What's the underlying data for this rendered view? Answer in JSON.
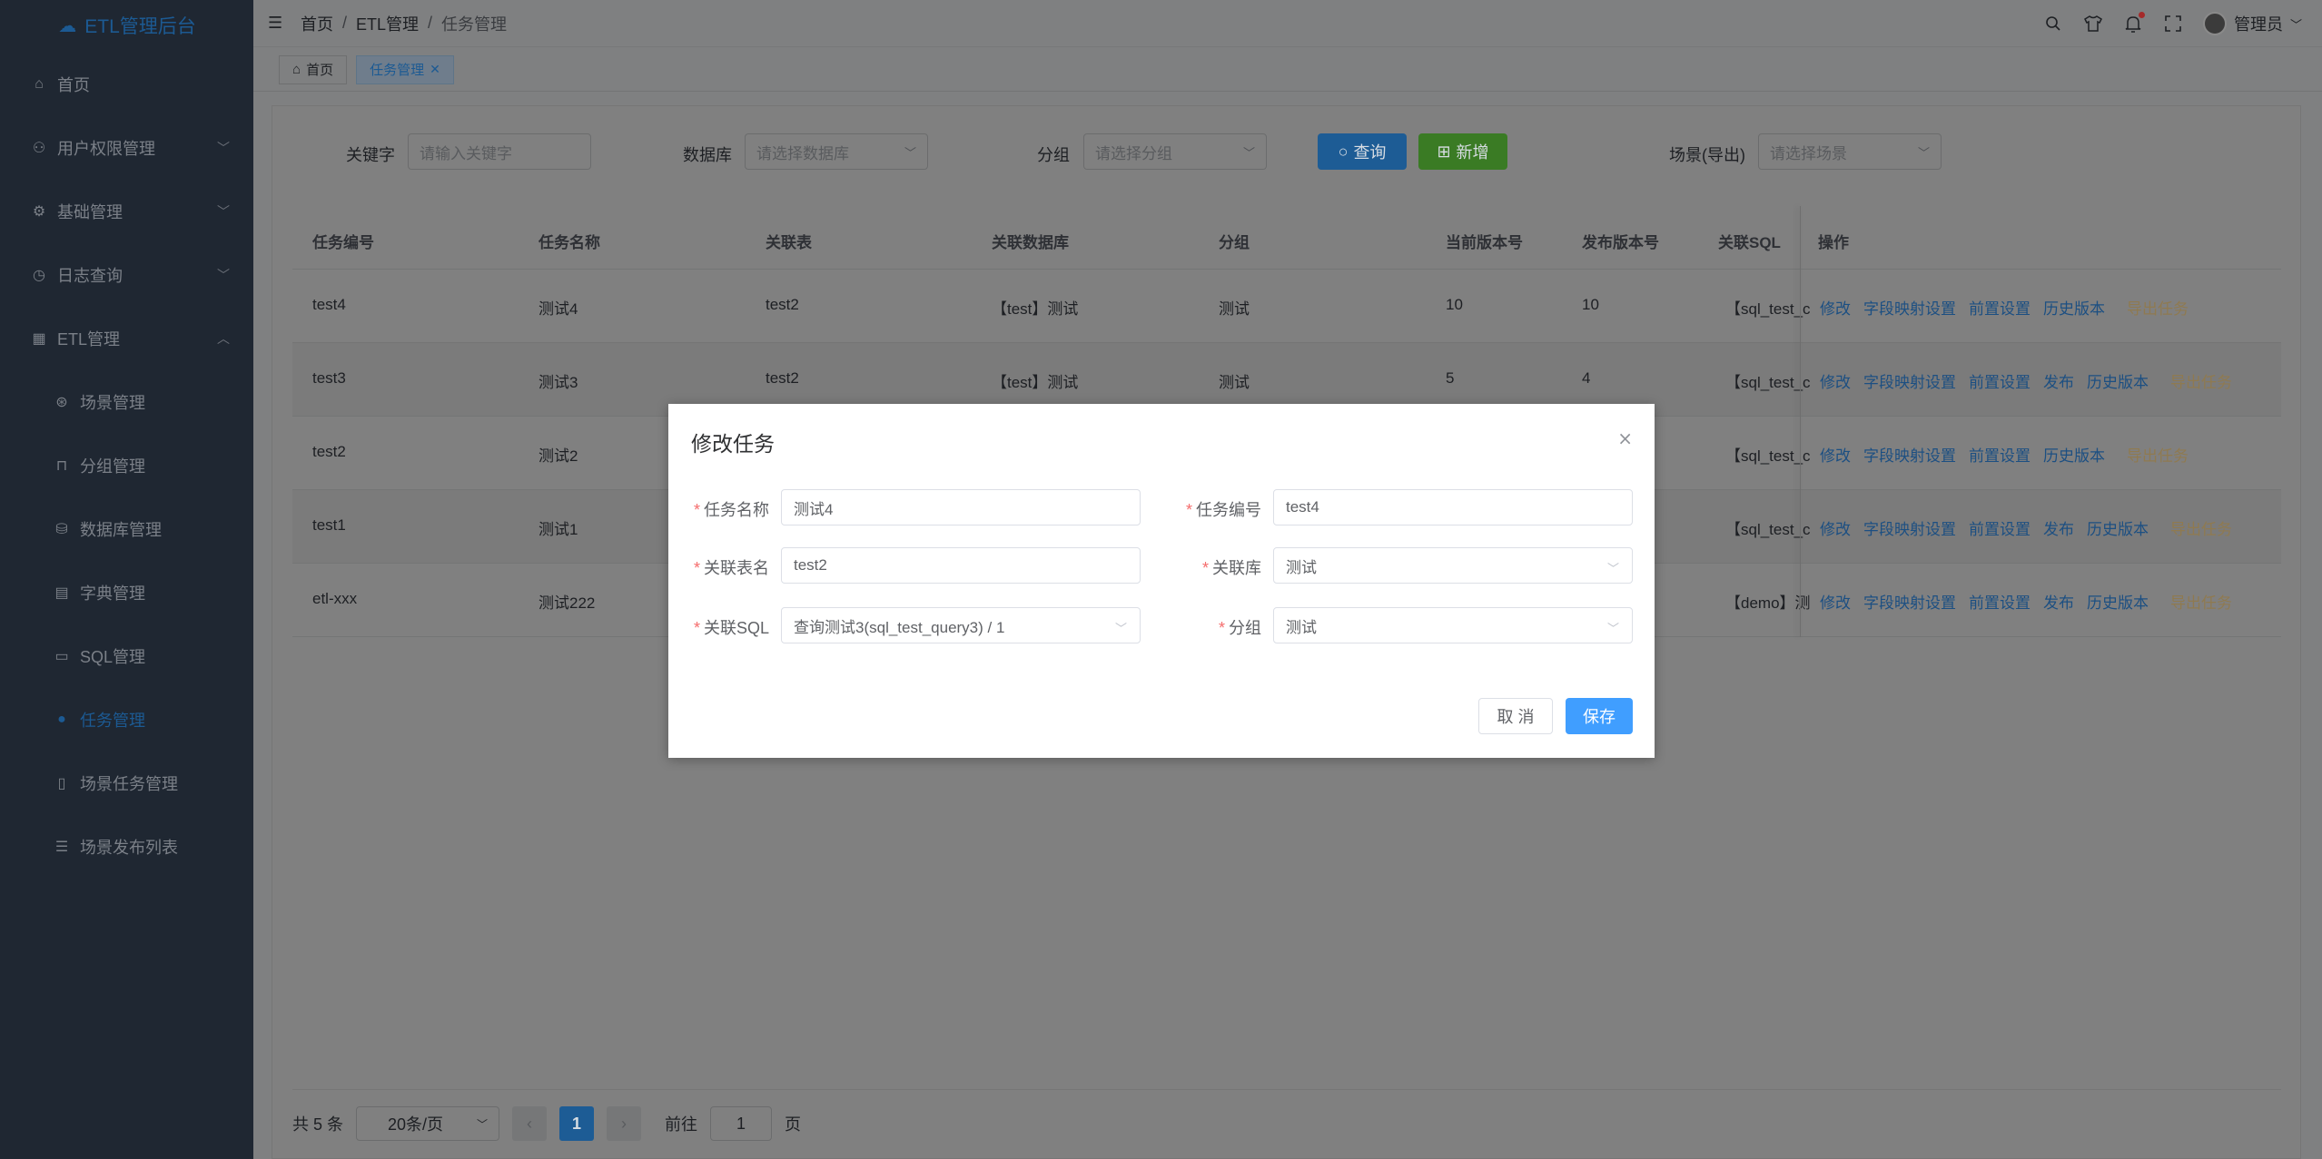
{
  "brand": {
    "title": "ETL管理后台",
    "logo_icon": "cloud-icon"
  },
  "sidebar": {
    "items": [
      {
        "label": "首页",
        "icon": "home-icon",
        "level": "top"
      },
      {
        "label": "用户权限管理",
        "icon": "user-icon",
        "level": "top",
        "arrow": "﹀"
      },
      {
        "label": "基础管理",
        "icon": "settings-icon",
        "level": "top",
        "arrow": "﹀"
      },
      {
        "label": "日志查询",
        "icon": "clock-icon",
        "level": "top",
        "arrow": "﹀"
      },
      {
        "label": "ETL管理",
        "icon": "calendar-icon",
        "level": "top",
        "arrow": "︿"
      },
      {
        "label": "场景管理",
        "icon": "scene-icon",
        "level": "sub"
      },
      {
        "label": "分组管理",
        "icon": "lock-icon",
        "level": "sub"
      },
      {
        "label": "数据库管理",
        "icon": "database-icon",
        "level": "sub"
      },
      {
        "label": "字典管理",
        "icon": "box-icon",
        "level": "sub"
      },
      {
        "label": "SQL管理",
        "icon": "folder-icon",
        "level": "sub"
      },
      {
        "label": "任务管理",
        "icon": "pin-icon",
        "level": "sub",
        "active": true
      },
      {
        "label": "场景任务管理",
        "icon": "document-icon",
        "level": "sub"
      },
      {
        "label": "场景发布列表",
        "icon": "list-icon",
        "level": "sub"
      }
    ]
  },
  "header": {
    "breadcrumb": [
      "首页",
      "ETL管理",
      "任务管理"
    ],
    "separator": "/",
    "user_name": "管理员",
    "user_arrow": "﹀"
  },
  "tags": [
    {
      "label": "首页",
      "active": false
    },
    {
      "label": "任务管理",
      "active": true,
      "close": "✕"
    }
  ],
  "filters": {
    "keyword_label": "关键字",
    "keyword_placeholder": "请输入关键字",
    "database_label": "数据库",
    "database_placeholder": "请选择数据库",
    "group_label": "分组",
    "group_placeholder": "请选择分组",
    "query_button": "查询",
    "add_button": "新增",
    "scene_label": "场景(导出)",
    "scene_placeholder": "请选择场景",
    "caret": "﹀"
  },
  "table": {
    "columns": [
      "任务编号",
      "任务名称",
      "关联表",
      "关联数据库",
      "分组",
      "当前版本号",
      "发布版本号",
      "关联SQL",
      "操作"
    ],
    "rows": [
      {
        "id": "test4",
        "name": "测试4",
        "table": "test2",
        "db": "【test】测试",
        "group": "测试",
        "cur": "10",
        "pub": "10",
        "sql": "【sql_test_c",
        "ops": [
          "修改",
          "字段映射设置",
          "前置设置",
          "历史版本"
        ],
        "export": "导出任务"
      },
      {
        "id": "test3",
        "name": "测试3",
        "table": "test2",
        "db": "【test】测试",
        "group": "测试",
        "cur": "5",
        "pub": "4",
        "sql": "【sql_test_c",
        "ops": [
          "修改",
          "字段映射设置",
          "前置设置",
          "发布",
          "历史版本"
        ],
        "export": "导出任务"
      },
      {
        "id": "test2",
        "name": "测试2",
        "table": "",
        "db": "",
        "group": "",
        "cur": "",
        "pub": "",
        "sql": "【sql_test_c",
        "ops": [
          "修改",
          "字段映射设置",
          "前置设置",
          "历史版本"
        ],
        "export": "导出任务"
      },
      {
        "id": "test1",
        "name": "测试1",
        "table": "",
        "db": "",
        "group": "",
        "cur": "",
        "pub": "",
        "sql": "【sql_test_c",
        "ops": [
          "修改",
          "字段映射设置",
          "前置设置",
          "发布",
          "历史版本"
        ],
        "export": "导出任务"
      },
      {
        "id": "etl-xxx",
        "name": "测试222",
        "table": "",
        "db": "",
        "group": "",
        "cur": "",
        "pub": "",
        "sql": "【demo】测",
        "ops": [
          "修改",
          "字段映射设置",
          "前置设置",
          "发布",
          "历史版本"
        ],
        "export": "导出任务"
      }
    ]
  },
  "pagination": {
    "total": "共 5 条",
    "page_size": "20条/页",
    "prev": "‹",
    "current": "1",
    "next": "›",
    "goto_label": "前往",
    "goto_value": "1",
    "page_suffix": "页"
  },
  "dialog": {
    "title": "修改任务",
    "close": "×",
    "fields": {
      "task_name_label": "任务名称",
      "task_name_value": "测试4",
      "task_code_label": "任务编号",
      "task_code_value": "test4",
      "table_label": "关联表名",
      "table_value": "test2",
      "db_label": "关联库",
      "db_value": "测试",
      "sql_label": "关联SQL",
      "sql_value": "查询测试3(sql_test_query3) / 1",
      "group_label": "分组",
      "group_value": "测试",
      "required_mark": "*",
      "caret": "﹀"
    },
    "cancel_button": "取 消",
    "save_button": "保存"
  },
  "colors": {
    "sidebar_bg": "#1f2732",
    "overlay_bg": "#7f8081",
    "primary": "#409eff",
    "success": "#67c23a",
    "warning": "#e6a23c",
    "danger": "#f56c6c"
  }
}
